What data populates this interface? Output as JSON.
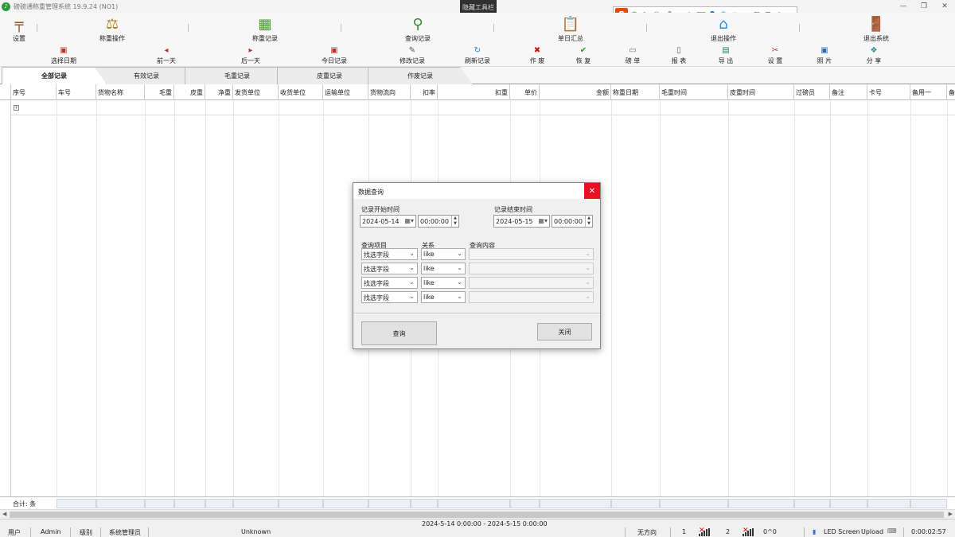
{
  "window": {
    "title": "磅磅通称重管理系统 19.9.24 (NO1)",
    "hide_toolbar_label": "隐藏工具栏",
    "controls": [
      "minimize-icon",
      "restore-icon",
      "close-icon"
    ]
  },
  "ime": {
    "logo": "S",
    "items": [
      "中",
      "°,",
      "☺",
      "🎤",
      "▣",
      "✎",
      "⌨",
      "👤",
      "👕",
      "⊞",
      "✂",
      "🎮",
      "☰",
      "✲"
    ]
  },
  "main_toolbar": [
    {
      "label": "设置",
      "icon": "signpost-icon"
    },
    {
      "label": "称重操作",
      "icon": "scale-icon"
    },
    {
      "label": "称重记录",
      "icon": "records-icon"
    },
    {
      "label": "查询记录",
      "icon": "magnifier-icon"
    },
    {
      "label": "单日汇总",
      "icon": "clipboard-icon"
    },
    {
      "label": "退出操作",
      "icon": "shop-icon"
    },
    {
      "label": "退出系统",
      "icon": "exit-door-icon"
    }
  ],
  "sub_toolbar": [
    {
      "label": "选择日期",
      "icon": "calendar-icon"
    },
    {
      "label": "前一天",
      "icon": "prev-day-icon"
    },
    {
      "label": "后一天",
      "icon": "next-day-icon"
    },
    {
      "label": "今日记录",
      "icon": "today-icon"
    },
    {
      "label": "修改记录",
      "icon": "edit-icon"
    },
    {
      "label": "刷新记录",
      "icon": "refresh-icon"
    },
    {
      "label": "作 废",
      "icon": "void-icon"
    },
    {
      "label": "恢 复",
      "icon": "check-icon"
    },
    {
      "label": "磅 单",
      "icon": "ticket-icon"
    },
    {
      "label": "报 表",
      "icon": "report-icon"
    },
    {
      "label": "导 出",
      "icon": "export-icon"
    },
    {
      "label": "设 置",
      "icon": "tools-icon"
    },
    {
      "label": "照 片",
      "icon": "photo-icon"
    },
    {
      "label": "分 享",
      "icon": "share-icon"
    }
  ],
  "tabs": [
    "全部记录",
    "有效记录",
    "毛重记录",
    "皮重记录",
    "作废记录"
  ],
  "active_tab": "全部记录",
  "columns": [
    "序号",
    "车号",
    "货物名称",
    "毛重",
    "皮重",
    "净重",
    "发货单位",
    "收货单位",
    "运输单位",
    "货物流向",
    "扣率",
    "扣重",
    "单价",
    "金额",
    "称重日期",
    "毛重时间",
    "皮重时间",
    "过磅员",
    "备注",
    "卡号",
    "备用一",
    "备"
  ],
  "total_row": {
    "label": "合计:  条"
  },
  "statusbar": {
    "user_label": "用户",
    "user_value": "Admin",
    "level_label": "级别",
    "level_value": "系统管理员",
    "unknown": "Unknown",
    "date_range": "2024-5-14 0:00:00 - 2024-5-15 0:00:00",
    "direction": "无方向",
    "ch1": "1",
    "ch2": "2",
    "weight": "0^0",
    "led": "LED Screen",
    "upload": "Upload",
    "timer": "0:00:02:57"
  },
  "dialog": {
    "title": "数据查询",
    "start_label": "记录开始时间",
    "start_date": "2024-05-14",
    "start_time": "00:00:00",
    "end_label": "记录结束时间",
    "end_date": "2024-05-15",
    "end_time": "00:00:00",
    "col_query_item": "查询项目",
    "col_relation": "关系",
    "col_content": "查询内容",
    "rows": [
      {
        "field": "找选字段",
        "relation": "like",
        "content": ""
      },
      {
        "field": "找选字段",
        "relation": "like",
        "content": ""
      },
      {
        "field": "找选字段",
        "relation": "like",
        "content": ""
      },
      {
        "field": "找选字段",
        "relation": "like",
        "content": ""
      }
    ],
    "query_button": "查询",
    "close_button": "关闭"
  }
}
